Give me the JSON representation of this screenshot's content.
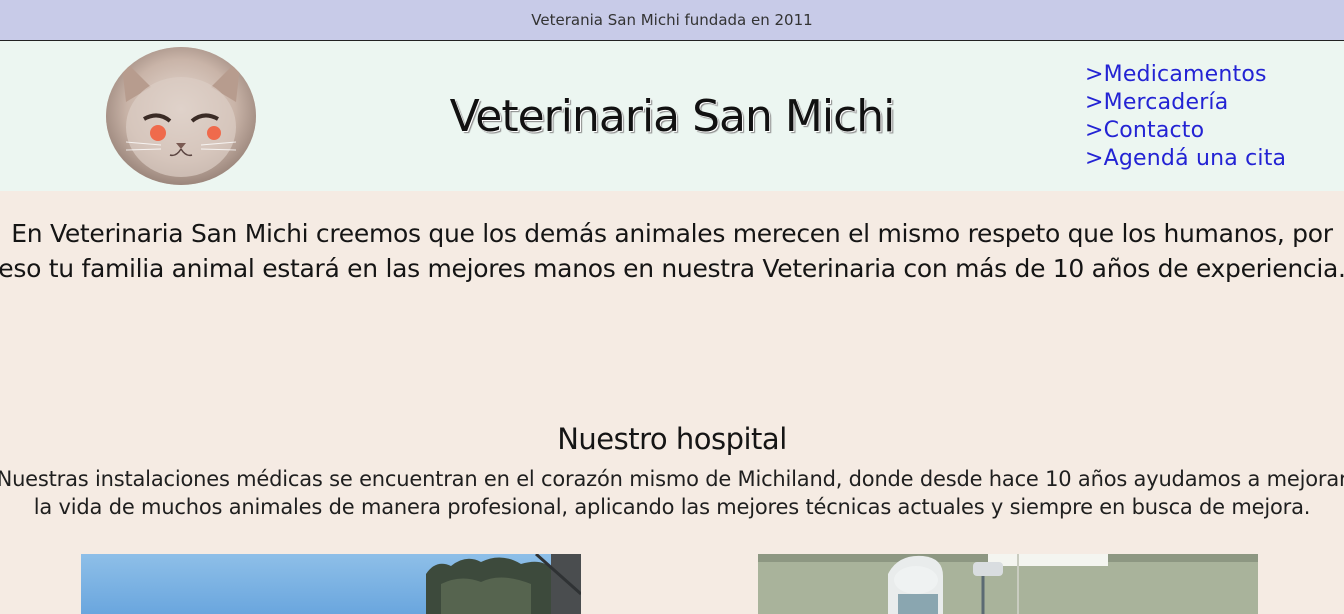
{
  "topbar": {
    "text": "Veterania San Michi fundada en 2011"
  },
  "header": {
    "logo_icon": "cat-photo",
    "title": "Veterinaria San Michi",
    "nav": [
      {
        "label": ">Medicamentos"
      },
      {
        "label": ">Mercadería"
      },
      {
        "label": ">Contacto"
      },
      {
        "label": ">Agendá una cita"
      }
    ]
  },
  "intro": {
    "text": "En Veterinaria San Michi creemos que los demás animales merecen el mismo respeto que los humanos, por eso tu familia animal estará en las mejores manos en nuestra Veterinaria con más de 10 años de experiencia."
  },
  "hospital": {
    "title": "Nuestro hospital",
    "text": "Nuestras instalaciones médicas se encuentran en el corazón mismo de Michiland, donde desde hace 10 años ayudamos a mejorar la vida de muchos animales de manera profesional, aplicando las mejores técnicas actuales y siempre en busca de mejora."
  },
  "colors": {
    "topbar_bg": "#c8cbe8",
    "header_bg": "#ecf6f1",
    "page_bg": "#f5ebe3",
    "link": "#2323d4"
  }
}
